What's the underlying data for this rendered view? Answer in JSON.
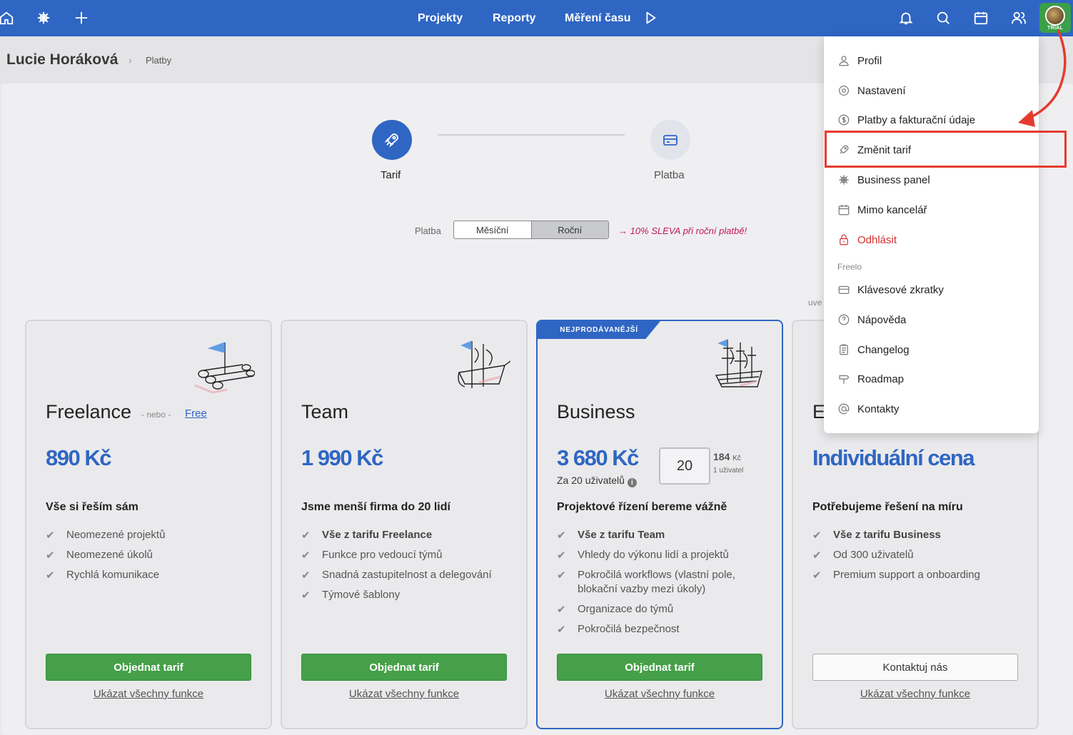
{
  "topnav": {
    "projekty": "Projekty",
    "reporty": "Reporty",
    "mereni": "Měření času",
    "trial": "TRIAL"
  },
  "header": {
    "user": "Lucie Horáková",
    "breadcrumb": "Platby"
  },
  "steps": {
    "step1": "Tarif",
    "step2": "Platba"
  },
  "billing": {
    "label": "Platba",
    "monthly": "Měsíční",
    "yearly": "Roční",
    "discount": "→ 10% SLEVA při roční platbě!",
    "partial": "uve"
  },
  "plans": [
    {
      "name": "Freelance",
      "nebo": "- nebo -",
      "free": "Free",
      "price": "890 Kč",
      "tagline": "Vše si řeším sám",
      "features": [
        "Neomezené projektů",
        "Neomezené úkolů",
        "Rychlá komunikace"
      ],
      "button": "Objednat tarif",
      "all": "Ukázat všechny funkce"
    },
    {
      "name": "Team",
      "price": "1 990 Kč",
      "tagline": "Jsme menší firma do 20 lidí",
      "features": [
        "Vše z tarifu Freelance",
        "Funkce pro vedoucí týmů",
        "Snadná zastupitelnost a delegování",
        "Týmové šablony"
      ],
      "button": "Objednat tarif",
      "all": "Ukázat všechny funkce"
    },
    {
      "badge": "NEJPRODÁVANĚJŠÍ",
      "name": "Business",
      "price": "3 680 Kč",
      "sub": "Za 20 uživatelů",
      "qty": "20",
      "per_price": "184",
      "per_cur": "Kč",
      "per_unit": "1 uživatel",
      "tagline": "Projektové řízení bereme vážně",
      "features": [
        "Vše z tarifu Team",
        "Vhledy do výkonu lidí a projektů",
        "Pokročilá workflows (vlastní pole, blokační vazby mezi úkoly)",
        "Organizace do týmů",
        "Pokročilá bezpečnost"
      ],
      "button": "Objednat tarif",
      "all": "Ukázat všechny funkce"
    },
    {
      "name": "E",
      "price": "Individuální cena",
      "tagline": "Potřebujeme řešení na míru",
      "features": [
        "Vše z tarifu Business",
        "Od 300 uživatelů",
        "Premium support a onboarding"
      ],
      "button": "Kontaktuj nás",
      "all": "Ukázat všechny funkce"
    }
  ],
  "menu": {
    "profil": "Profil",
    "nastaveni": "Nastavení",
    "platby": "Platby a fakturační údaje",
    "zmenit": "Změnit tarif",
    "business": "Business panel",
    "mimo": "Mimo kancelář",
    "odhlasit": "Odhlásit",
    "section": "Freelo",
    "zkratky": "Klávesové zkratky",
    "napoveda": "Nápověda",
    "changelog": "Changelog",
    "roadmap": "Roadmap",
    "kontakty": "Kontakty"
  },
  "colors": {
    "brand": "#2f66c3",
    "order_button": "#45a049",
    "logout": "#d32f2f",
    "highlight": "#e53b2f",
    "discount": "#c2185b"
  },
  "icons": [
    "home-icon",
    "wheel-icon",
    "plus-icon",
    "play-icon",
    "bell-icon",
    "search-icon",
    "calendar-icon",
    "users-icon",
    "rocket-icon",
    "card-icon",
    "check-icon",
    "info-icon"
  ]
}
